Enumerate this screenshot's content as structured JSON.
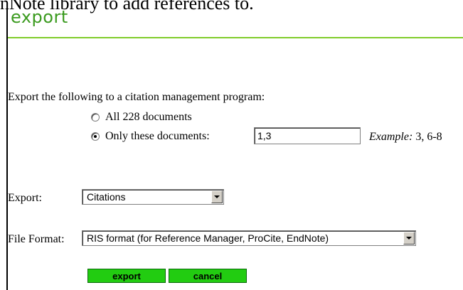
{
  "header": {
    "cut_text": "nNote library to add references to.",
    "title": "export"
  },
  "form": {
    "intro": "Export the following to a citation management program:",
    "options": [
      {
        "label": "All 228 documents",
        "checked": false
      },
      {
        "label": "Only these documents:",
        "checked": true
      }
    ],
    "documents_value": "1,3",
    "example_label": "Example:",
    "example_text": " 3, 6-8",
    "export_label": "Export:",
    "export_selected": "Citations",
    "format_label": "File Format:",
    "format_selected": "RIS format (for Reference Manager, ProCite, EndNote)"
  },
  "buttons": {
    "export": "export",
    "cancel": "cancel"
  },
  "colors": {
    "title": "#3a9a1e",
    "rule": "#7fcc2a",
    "button": "#22cc11"
  }
}
